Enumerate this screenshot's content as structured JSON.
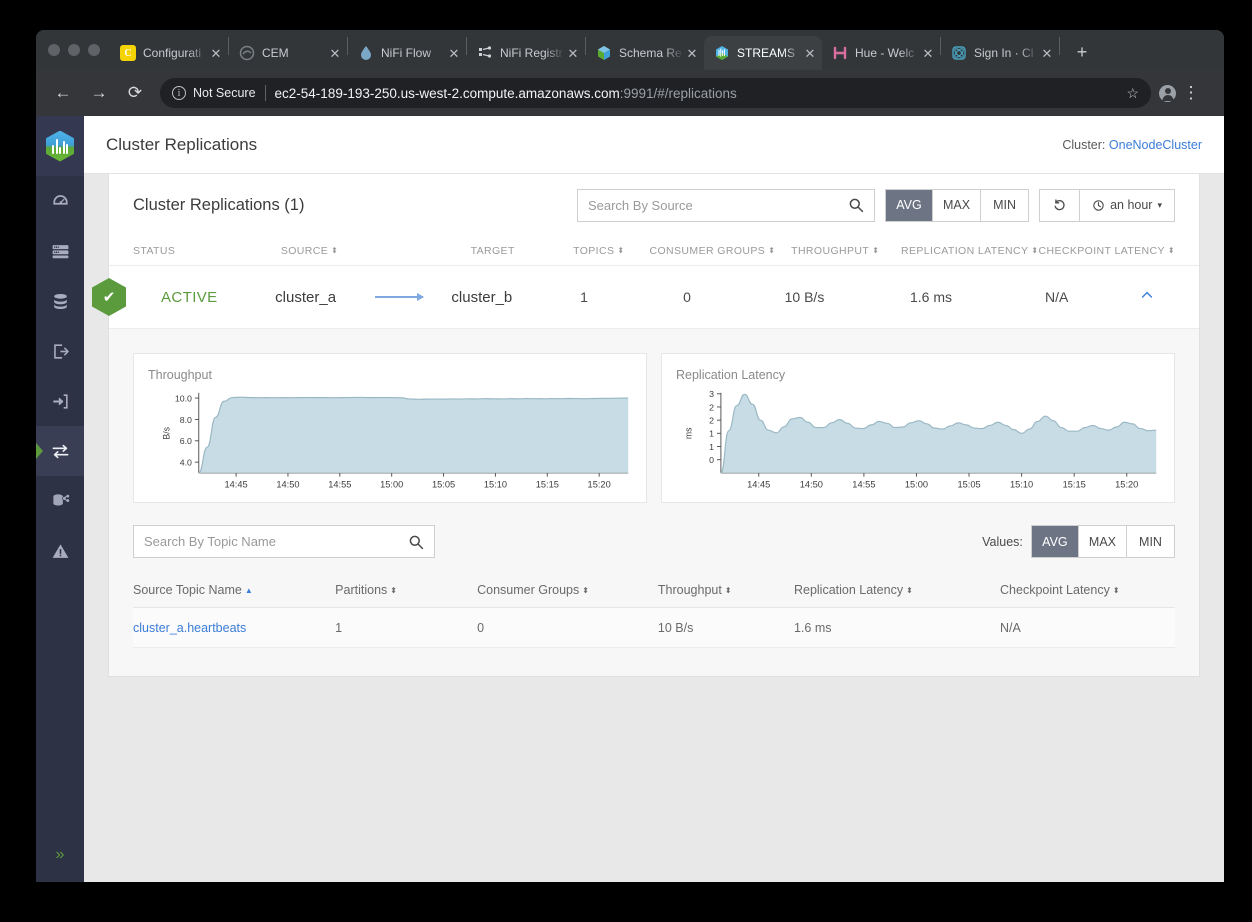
{
  "browser": {
    "tabs": [
      {
        "title": "Configurati",
        "favicon": "config-icon",
        "active": false
      },
      {
        "title": "CEM",
        "favicon": "cem-icon",
        "active": false
      },
      {
        "title": "NiFi Flow",
        "favicon": "nifi-icon",
        "active": false
      },
      {
        "title": "NiFi Registr",
        "favicon": "nifi-registry-icon",
        "active": false
      },
      {
        "title": "Schema Re",
        "favicon": "schema-registry-icon",
        "active": false
      },
      {
        "title": "STREAMS ",
        "favicon": "streams-messaging-icon",
        "active": true
      },
      {
        "title": "Hue - Welc",
        "favicon": "hue-icon",
        "active": false
      },
      {
        "title": "Sign In · Cl",
        "favicon": "signin-icon",
        "active": false
      }
    ],
    "new_tab_label": "+",
    "close_label": "✕",
    "back_label": "←",
    "forward_label": "→",
    "reload_label": "⟳",
    "security_label": "Not Secure",
    "url_main": "ec2-54-189-193-250.us-west-2.compute.amazonaws.com",
    "url_dim": ":9991/#/replications",
    "star_label": "☆",
    "menu_label": "⋮"
  },
  "sidebar": {
    "logo_name": "streams-messaging-manager-logo",
    "items": [
      {
        "name": "sidebar-item-dashboard",
        "icon": "gauge-icon",
        "active": false
      },
      {
        "name": "sidebar-item-brokers",
        "icon": "server-rack-icon",
        "active": false
      },
      {
        "name": "sidebar-item-topics",
        "icon": "database-icon",
        "active": false
      },
      {
        "name": "sidebar-item-producers",
        "icon": "export-arrow-icon",
        "active": false
      },
      {
        "name": "sidebar-item-consumers",
        "icon": "import-arrow-icon",
        "active": false
      },
      {
        "name": "sidebar-item-replications",
        "icon": "two-way-arrows-icon",
        "active": true
      },
      {
        "name": "sidebar-item-topic-lineage",
        "icon": "data-share-icon",
        "active": false
      },
      {
        "name": "sidebar-item-alerts",
        "icon": "warning-triangle-icon",
        "active": false
      }
    ],
    "expand_label": "»"
  },
  "header": {
    "title": "Cluster Replications",
    "cluster_prefix": "Cluster:",
    "cluster_name": "OneNodeCluster"
  },
  "toolbar": {
    "heading": "Cluster Replications (1)",
    "search_placeholder": "Search By Source",
    "search_value": "",
    "search_icon": "search-icon",
    "aggregations": [
      {
        "label": "AVG",
        "active": true
      },
      {
        "label": "MAX",
        "active": false
      },
      {
        "label": "MIN",
        "active": false
      }
    ],
    "refresh_icon": "refresh-icon",
    "refresh_label": "↺",
    "time_range_icon": "clock-icon",
    "time_range_label": "an hour",
    "time_range_caret": "▾"
  },
  "replications_table": {
    "columns": [
      {
        "label": "STATUS",
        "sortable": false
      },
      {
        "label": "SOURCE",
        "sortable": true
      },
      {
        "label": "TARGET",
        "sortable": false
      },
      {
        "label": "TOPICS",
        "sortable": true
      },
      {
        "label": "CONSUMER GROUPS",
        "sortable": true
      },
      {
        "label": "THROUGHPUT",
        "sortable": true
      },
      {
        "label": "REPLICATION LATENCY",
        "sortable": true
      },
      {
        "label": "CHECKPOINT LATENCY",
        "sortable": true
      }
    ],
    "rows": [
      {
        "status": "ACTIVE",
        "status_icon": "check-hexagon-icon",
        "source": "cluster_a",
        "target": "cluster_b",
        "topics": "1",
        "consumer_groups": "0",
        "throughput": "10 B/s",
        "replication_latency": "1.6 ms",
        "checkpoint_latency": "N/A",
        "expanded": true,
        "chevron": "⌃"
      }
    ]
  },
  "charts": {
    "throughput": {
      "title": "Throughput",
      "ylabel": "B/s"
    },
    "replication_latency": {
      "title": "Replication Latency",
      "ylabel": "ms"
    }
  },
  "chart_data": [
    {
      "type": "area",
      "title": "Throughput",
      "xlabel": "",
      "ylabel": "B/s",
      "ylim": [
        3.0,
        10.4
      ],
      "yticks": [
        "10.0",
        "8.0",
        "6.0",
        "4.0"
      ],
      "ytick_values": [
        10.0,
        8.0,
        6.0,
        4.0
      ],
      "xticks": [
        "14:45",
        "14:50",
        "14:55",
        "15:00",
        "15:05",
        "15:10",
        "15:15",
        "15:20"
      ],
      "grid": false,
      "legend": "none",
      "series": [
        {
          "name": "Throughput",
          "values": [
            3.0,
            5.4,
            8.2,
            9.7,
            10.05,
            10.08,
            10.05,
            10.03,
            10.04,
            10.03,
            10.04,
            10.03,
            10.04,
            10.05,
            10.04,
            10.04,
            10.03,
            10.04,
            10.05,
            10.06,
            10.05,
            10.04,
            10.05,
            10.04,
            10.03,
            9.92,
            9.88,
            9.9,
            9.91,
            9.9,
            9.92,
            9.91,
            9.93,
            9.92,
            9.94,
            9.93,
            9.92,
            9.94,
            9.93,
            9.95,
            9.94,
            9.93,
            9.95,
            9.94,
            9.96,
            9.95,
            9.94,
            9.96,
            9.97,
            9.98,
            9.99,
            10.0
          ]
        }
      ]
    },
    {
      "type": "area",
      "title": "Replication Latency",
      "xlabel": "",
      "ylabel": "ms",
      "ylim": [
        0,
        3.0
      ],
      "yticks": [
        "3",
        "2",
        "2",
        "1",
        "1",
        "0"
      ],
      "ytick_values": [
        3.0,
        2.5,
        2.0,
        1.5,
        1.0,
        0.5
      ],
      "xticks": [
        "14:45",
        "14:50",
        "14:55",
        "15:00",
        "15:05",
        "15:10",
        "15:15",
        "15:20"
      ],
      "grid": false,
      "legend": "none",
      "series": [
        {
          "name": "Replication Latency",
          "values": [
            0.0,
            1.6,
            2.55,
            2.98,
            2.6,
            2.0,
            1.62,
            1.52,
            1.75,
            2.05,
            2.1,
            1.92,
            1.72,
            1.72,
            1.9,
            2.02,
            1.88,
            1.7,
            1.68,
            1.82,
            1.95,
            1.88,
            1.72,
            1.74,
            1.9,
            1.98,
            1.86,
            1.7,
            1.66,
            1.78,
            1.9,
            1.82,
            1.7,
            1.68,
            1.8,
            1.92,
            1.8,
            1.64,
            1.5,
            1.66,
            1.95,
            2.15,
            1.98,
            1.72,
            1.58,
            1.58,
            1.72,
            1.8,
            1.68,
            1.62,
            1.74,
            1.92,
            1.86,
            1.68,
            1.6,
            1.62
          ]
        }
      ]
    }
  ],
  "topics": {
    "search_placeholder": "Search By Topic Name",
    "search_value": "",
    "search_icon": "search-icon",
    "values_label": "Values:",
    "aggregations": [
      {
        "label": "AVG",
        "active": true
      },
      {
        "label": "MAX",
        "active": false
      },
      {
        "label": "MIN",
        "active": false
      }
    ],
    "columns": [
      {
        "label": "Source Topic Name",
        "sort": "asc"
      },
      {
        "label": "Partitions",
        "sort": "none"
      },
      {
        "label": "Consumer Groups",
        "sort": "none"
      },
      {
        "label": "Throughput",
        "sort": "none"
      },
      {
        "label": "Replication Latency",
        "sort": "none"
      },
      {
        "label": "Checkpoint Latency",
        "sort": "none"
      }
    ],
    "rows": [
      {
        "name": "cluster_a.heartbeats",
        "partitions": "1",
        "consumer_groups": "0",
        "throughput": "10 B/s",
        "replication_latency": "1.6 ms",
        "checkpoint_latency": "N/A"
      }
    ]
  },
  "colors": {
    "accent_blue": "#3b7dd8",
    "status_green": "#5b9b3e",
    "chart_fill": "#c7dce5",
    "chart_stroke": "#9ab8c4",
    "nav_bg": "#2e3245",
    "seg_active": "#6d7585"
  }
}
